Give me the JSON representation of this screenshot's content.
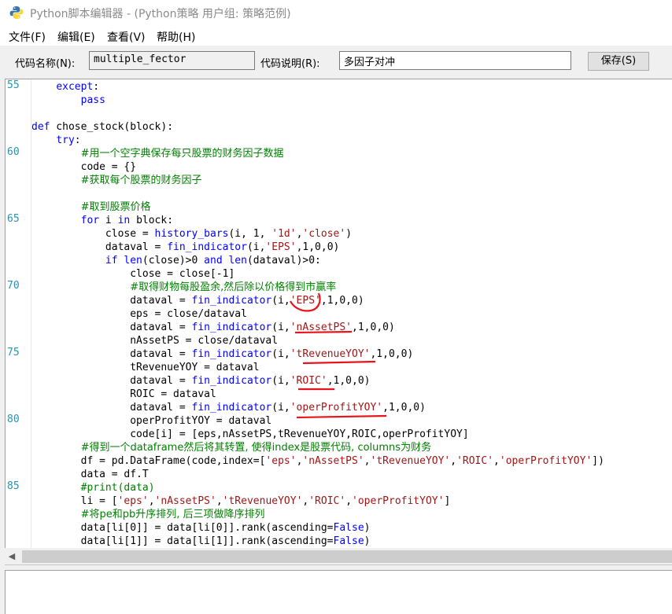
{
  "window": {
    "title": "Python脚本编辑器 - (Python策略 用户组: 策略范例)",
    "icon": "python-icon"
  },
  "menu": [
    {
      "label": "文件(F)"
    },
    {
      "label": "编辑(E)"
    },
    {
      "label": "查看(V)"
    },
    {
      "label": "帮助(H)"
    }
  ],
  "toolbar": {
    "code_name_label": "代码名称(N):",
    "code_name_value": "multiple_fector",
    "code_desc_label": "代码说明(R):",
    "code_desc_value": "多因子对冲",
    "save_label": "保存(S)"
  },
  "editor": {
    "line_numbers": [
      "55",
      "60",
      "65",
      "70",
      "75",
      "80",
      "85"
    ],
    "lines": [
      {
        "parts": [
          {
            "t": "    "
          },
          {
            "t": "except",
            "c": "kw"
          },
          {
            "t": ":"
          }
        ]
      },
      {
        "parts": [
          {
            "t": "        "
          },
          {
            "t": "pass",
            "c": "kw"
          }
        ]
      },
      {
        "parts": []
      },
      {
        "parts": [
          {
            "t": "def",
            "c": "kw"
          },
          {
            "t": " chose_stock(block):"
          }
        ]
      },
      {
        "parts": [
          {
            "t": "    "
          },
          {
            "t": "try",
            "c": "kw"
          },
          {
            "t": ":"
          }
        ]
      },
      {
        "parts": [
          {
            "t": "        "
          },
          {
            "t": "#用一个空字典保存每只股票的财务因子数据",
            "c": "cm-t"
          }
        ]
      },
      {
        "parts": [
          {
            "t": "        code = {}"
          }
        ]
      },
      {
        "parts": [
          {
            "t": "        "
          },
          {
            "t": "#获取每个股票的财务因子",
            "c": "cm-t"
          }
        ]
      },
      {
        "parts": []
      },
      {
        "parts": [
          {
            "t": "        "
          },
          {
            "t": "#取到股票价格",
            "c": "cm-t"
          }
        ]
      },
      {
        "parts": [
          {
            "t": "        "
          },
          {
            "t": "for",
            "c": "kw"
          },
          {
            "t": " i "
          },
          {
            "t": "in",
            "c": "kw"
          },
          {
            "t": " block:"
          }
        ]
      },
      {
        "parts": [
          {
            "t": "            close = "
          },
          {
            "t": "history_bars",
            "c": "fn"
          },
          {
            "t": "(i, 1, "
          },
          {
            "t": "'1d'",
            "c": "st"
          },
          {
            "t": ","
          },
          {
            "t": "'close'",
            "c": "st"
          },
          {
            "t": ")"
          }
        ]
      },
      {
        "parts": [
          {
            "t": "            dataval = "
          },
          {
            "t": "fin_indicator",
            "c": "fn"
          },
          {
            "t": "(i,"
          },
          {
            "t": "'EPS'",
            "c": "st"
          },
          {
            "t": ",1,0,0)"
          }
        ]
      },
      {
        "parts": [
          {
            "t": "            "
          },
          {
            "t": "if",
            "c": "kw"
          },
          {
            "t": " "
          },
          {
            "t": "len",
            "c": "fn"
          },
          {
            "t": "(close)>0 "
          },
          {
            "t": "and",
            "c": "kw"
          },
          {
            "t": " "
          },
          {
            "t": "len",
            "c": "fn"
          },
          {
            "t": "(dataval)>0:"
          }
        ]
      },
      {
        "parts": [
          {
            "t": "                close = close[-1]"
          }
        ]
      },
      {
        "parts": [
          {
            "t": "                "
          },
          {
            "t": "#取得财物每股盈余,然后除以价格得到市赢率",
            "c": "cm-t"
          }
        ]
      },
      {
        "parts": [
          {
            "t": "                dataval = "
          },
          {
            "t": "fin_indicator",
            "c": "fn"
          },
          {
            "t": "(i,"
          },
          {
            "t": "'EPS'",
            "c": "st"
          },
          {
            "t": ",1,0,0)"
          }
        ]
      },
      {
        "parts": [
          {
            "t": "                eps = close/dataval"
          }
        ]
      },
      {
        "parts": [
          {
            "t": "                dataval = "
          },
          {
            "t": "fin_indicator",
            "c": "fn"
          },
          {
            "t": "(i,"
          },
          {
            "t": "'nAssetPS'",
            "c": "st"
          },
          {
            "t": ",1,0,0)"
          }
        ]
      },
      {
        "parts": [
          {
            "t": "                nAssetPS = close/dataval"
          }
        ]
      },
      {
        "parts": [
          {
            "t": "                dataval = "
          },
          {
            "t": "fin_indicator",
            "c": "fn"
          },
          {
            "t": "(i,"
          },
          {
            "t": "'tRevenueYOY'",
            "c": "st"
          },
          {
            "t": ",1,0,0)"
          }
        ]
      },
      {
        "parts": [
          {
            "t": "                tRevenueYOY = dataval"
          }
        ]
      },
      {
        "parts": [
          {
            "t": "                dataval = "
          },
          {
            "t": "fin_indicator",
            "c": "fn"
          },
          {
            "t": "(i,"
          },
          {
            "t": "'ROIC'",
            "c": "st"
          },
          {
            "t": ",1,0,0)"
          }
        ]
      },
      {
        "parts": [
          {
            "t": "                ROIC = dataval"
          }
        ]
      },
      {
        "parts": [
          {
            "t": "                dataval = "
          },
          {
            "t": "fin_indicator",
            "c": "fn"
          },
          {
            "t": "(i,"
          },
          {
            "t": "'operProfitYOY'",
            "c": "st"
          },
          {
            "t": ",1,0,0)"
          }
        ]
      },
      {
        "parts": [
          {
            "t": "                operProfitYOY = dataval"
          }
        ]
      },
      {
        "parts": [
          {
            "t": "                code[i] = [eps,nAssetPS,tRevenueYOY,ROIC,operProfitYOY]"
          }
        ]
      },
      {
        "parts": [
          {
            "t": "        "
          },
          {
            "t": "#得到一个dataframe然后将其转置, 使得index是股票代码, columns为财务",
            "c": "cm-t"
          }
        ]
      },
      {
        "parts": [
          {
            "t": "        df = pd.DataFrame(code,index=["
          },
          {
            "t": "'eps'",
            "c": "st"
          },
          {
            "t": ","
          },
          {
            "t": "'nAssetPS'",
            "c": "st"
          },
          {
            "t": ","
          },
          {
            "t": "'tRevenueYOY'",
            "c": "st"
          },
          {
            "t": ","
          },
          {
            "t": "'ROIC'",
            "c": "st"
          },
          {
            "t": ","
          },
          {
            "t": "'operProfitYOY'",
            "c": "st"
          },
          {
            "t": "])"
          }
        ]
      },
      {
        "parts": [
          {
            "t": "        data = df.T"
          }
        ]
      },
      {
        "parts": [
          {
            "t": "        "
          },
          {
            "t": "#print(data)",
            "c": "cm"
          }
        ]
      },
      {
        "parts": [
          {
            "t": "        li = ["
          },
          {
            "t": "'eps'",
            "c": "st"
          },
          {
            "t": ","
          },
          {
            "t": "'nAssetPS'",
            "c": "st"
          },
          {
            "t": ","
          },
          {
            "t": "'tRevenueYOY'",
            "c": "st"
          },
          {
            "t": ","
          },
          {
            "t": "'ROIC'",
            "c": "st"
          },
          {
            "t": ","
          },
          {
            "t": "'operProfitYOY'",
            "c": "st"
          },
          {
            "t": "]"
          }
        ]
      },
      {
        "parts": [
          {
            "t": "        "
          },
          {
            "t": "#将pe和pb升序排列, 后三项做降序排列",
            "c": "cm-t"
          }
        ]
      },
      {
        "parts": [
          {
            "t": "        data[li[0]] = data[li[0]].rank(ascending="
          },
          {
            "t": "False",
            "c": "kw"
          },
          {
            "t": ")"
          }
        ]
      },
      {
        "parts": [
          {
            "t": "        data[li[1]] = data[li[1]].rank(ascending="
          },
          {
            "t": "False",
            "c": "kw"
          },
          {
            "t": ")"
          }
        ]
      }
    ]
  },
  "colors": {
    "keyword": "#0000ff",
    "string": "#a31515",
    "comment": "#008000",
    "line_number": "#2b91af",
    "annotation": "#e8141c"
  }
}
